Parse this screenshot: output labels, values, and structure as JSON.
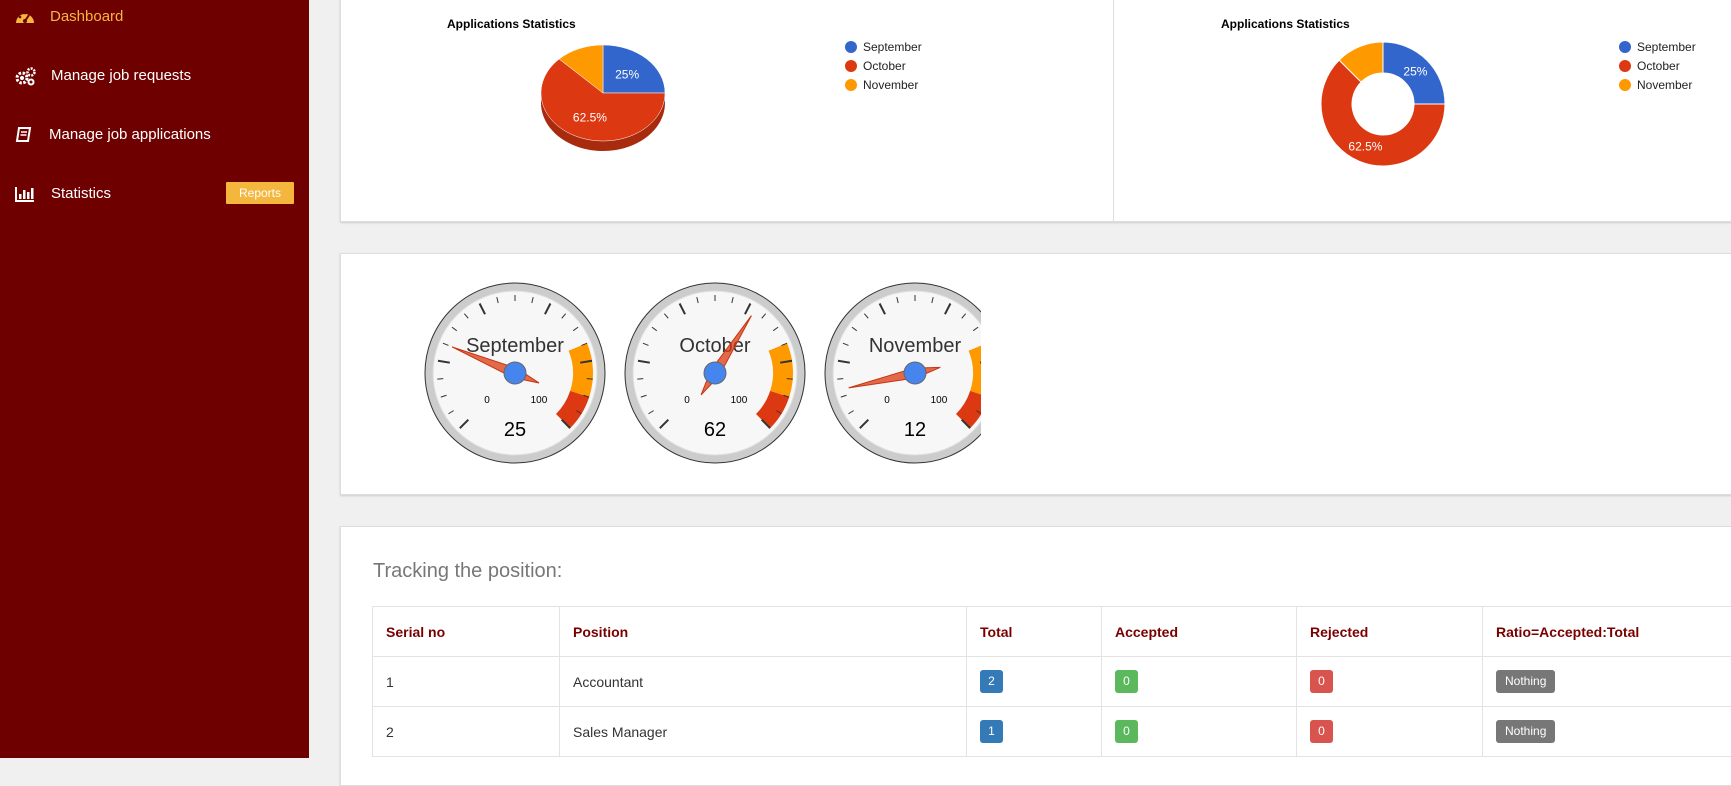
{
  "sidebar": {
    "items": [
      {
        "label": "Dashboard",
        "icon": "dashboard-icon"
      },
      {
        "label": "Manage job requests",
        "icon": "gears-icon"
      },
      {
        "label": "Manage job applications",
        "icon": "book-icon"
      },
      {
        "label": "Statistics",
        "icon": "bar-chart-icon"
      }
    ],
    "reports_badge": "Reports"
  },
  "colors": {
    "sidebar_bg": "#6e0000",
    "active": "#f5b63e",
    "september": "#3366cc",
    "october": "#dc3912",
    "november": "#ff9900"
  },
  "chart_data": [
    {
      "type": "pie",
      "variant": "3d",
      "title": "Applications Statistics",
      "categories": [
        "September",
        "October",
        "November"
      ],
      "values": [
        25,
        62.5,
        12.5
      ],
      "slice_labels": [
        "25%",
        "62.5%",
        ""
      ],
      "legend_position": "right"
    },
    {
      "type": "pie",
      "variant": "donut",
      "title": "Applications Statistics",
      "categories": [
        "September",
        "October",
        "November"
      ],
      "values": [
        25,
        62.5,
        12.5
      ],
      "slice_labels": [
        "25%",
        "62.5%",
        ""
      ],
      "legend_position": "right"
    },
    {
      "type": "gauge",
      "min": 0,
      "max": 100,
      "min_label": "0",
      "max_label": "100",
      "yellow_range": [
        75,
        90
      ],
      "red_range": [
        90,
        100
      ],
      "gauges": [
        {
          "label": "September",
          "value": 25
        },
        {
          "label": "October",
          "value": 62
        },
        {
          "label": "November",
          "value": 12
        }
      ]
    }
  ],
  "tracking": {
    "title": "Tracking the position:",
    "columns": [
      "Serial no",
      "Position",
      "Total",
      "Accepted",
      "Rejected",
      "Ratio=Accepted:Total"
    ],
    "rows": [
      {
        "serial": "1",
        "position": "Accountant",
        "total": "2",
        "accepted": "0",
        "rejected": "0",
        "ratio": "Nothing"
      },
      {
        "serial": "2",
        "position": "Sales Manager",
        "total": "1",
        "accepted": "0",
        "rejected": "0",
        "ratio": "Nothing"
      }
    ]
  }
}
